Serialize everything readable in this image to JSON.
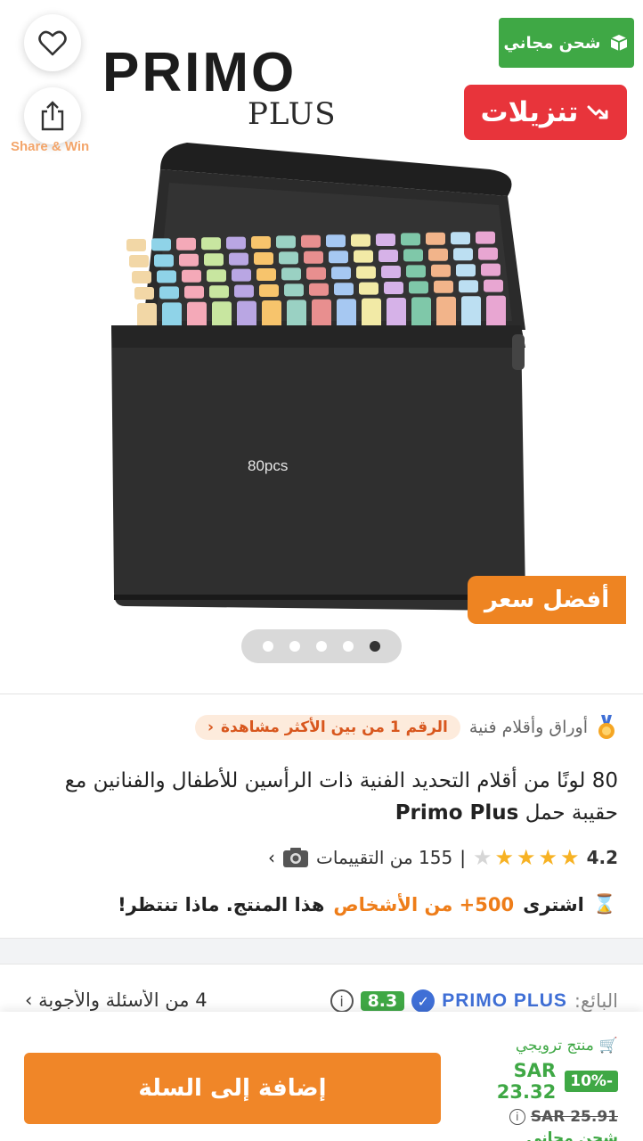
{
  "hero": {
    "logo_word": "PRIMO",
    "logo_sub": "PLUS",
    "share_win": "Share & Win",
    "free_shipping_badge": "شحن مجاني",
    "sales_badge": "تنزيلات",
    "best_price_badge": "أفضل سعر",
    "bag_label": "80pcs",
    "pager": {
      "count": 5,
      "active_index": 4
    },
    "icons": [
      "heart-icon",
      "share-icon",
      "truck-icon",
      "trend-down-icon"
    ]
  },
  "product": {
    "category": "أوراق وأقلام فنية",
    "most_viewed": "الرقم 1 من بين الأكثر مشاهدة",
    "title_brand": "Primo Plus",
    "title_rest": " 80 لونًا من أقلام التحديد الفنية ذات الرأسين للأطفال والفنانين مع حقيبة حمل",
    "rating_value": "4.2",
    "rating_stars": 4,
    "reviews_text": "155 من التقييمات",
    "bought_prefix": "اشترى",
    "bought_highlight": "500+ من الأشخاص",
    "bought_suffix": "هذا المنتج. ماذا تنتظر!"
  },
  "seller": {
    "label": "البائع:",
    "name": "PRIMO PLUS",
    "score": "8.3",
    "qa_link": "4 من الأسئلة والأجوبة"
  },
  "bottom": {
    "promo_label": "منتج ترويجي",
    "discount": "-10%",
    "price_now": "SAR 23.32",
    "price_old": "SAR 25.91",
    "shipping": "شحن مجاني",
    "add_to_cart": "إضافة إلى السلة"
  },
  "colors": {
    "accent_orange": "#f08628",
    "green": "#3fa845",
    "red": "#e8343b",
    "seller_blue": "#3f6fd6"
  }
}
